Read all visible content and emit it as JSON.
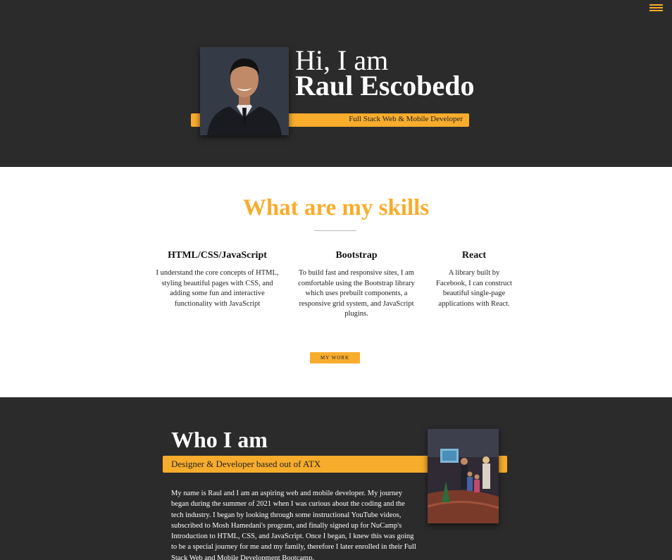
{
  "header": {
    "menu_icon": "hamburger-menu-icon",
    "greeting": "Hi, I am",
    "name": "Raul Escobedo",
    "subtitle": "Full Stack Web & Mobile Developer",
    "accent_color": "#f8ac2c",
    "background_color": "#2b2b2b"
  },
  "skills": {
    "title": "What are my skills",
    "items": [
      {
        "title": "HTML/CSS/JavaScript",
        "description": "I understand the core concepts of HTML, styling beautiful pages with CSS, and adding some fun and interactive functionality with JavaScript"
      },
      {
        "title": "Bootstrap",
        "description": "To build fast and responsive sites, I am comfortable using the Bootstrap library which uses prebuilt components, a responsive grid system, and JavaScript plugins."
      },
      {
        "title": "React",
        "description": "A library built by Facebook, I can construct beautiful single-page applications with React."
      }
    ],
    "button_label": "MY WORK"
  },
  "about": {
    "title": "Who I am",
    "subtitle": "Designer & Developer based out of ATX",
    "body": "My name is Raul and I am an aspiring web and mobile developer. My journey began during the summer of 2021 when I was curious about the coding and the tech industry. I began by looking through some instructional YouTube videos, subscribed to Mosh Hamedani's program, and finally signed up for NuCamp's Introduction to HTML, CSS, and JavaScript. Once I began, I knew this was going to be a special journey for me and my family, therefore I later enrolled in their Full Stack Web and Mobile Development Bootcamp."
  }
}
